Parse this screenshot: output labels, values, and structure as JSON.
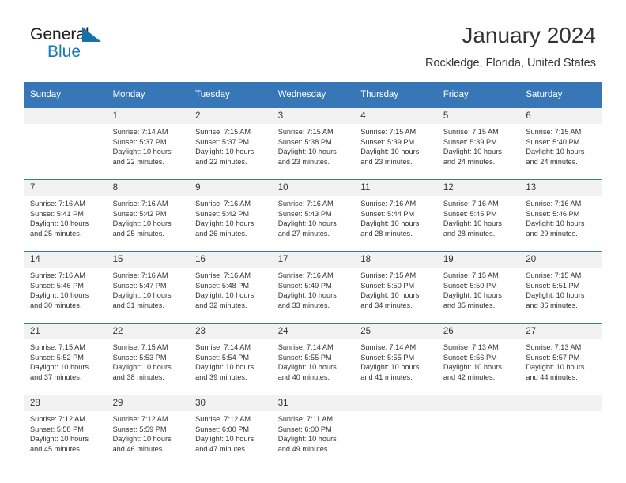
{
  "brand": {
    "name_part1": "General",
    "name_part2": "Blue",
    "accent_color": "#1278be",
    "triangle_color": "#1a6fad"
  },
  "header": {
    "title": "January 2024",
    "subtitle": "Rockledge, Florida, United States",
    "header_bg_color": "#3777b8"
  },
  "weekdays": [
    "Sunday",
    "Monday",
    "Tuesday",
    "Wednesday",
    "Thursday",
    "Friday",
    "Saturday"
  ],
  "labels": {
    "sunrise_prefix": "Sunrise:",
    "sunset_prefix": "Sunset:",
    "daylight_prefix": "Daylight:"
  },
  "weeks": [
    [
      {
        "empty": true
      },
      {
        "day": "1",
        "sunrise": "Sunrise: 7:14 AM",
        "sunset": "Sunset: 5:37 PM",
        "daylight": "Daylight: 10 hours and 22 minutes."
      },
      {
        "day": "2",
        "sunrise": "Sunrise: 7:15 AM",
        "sunset": "Sunset: 5:37 PM",
        "daylight": "Daylight: 10 hours and 22 minutes."
      },
      {
        "day": "3",
        "sunrise": "Sunrise: 7:15 AM",
        "sunset": "Sunset: 5:38 PM",
        "daylight": "Daylight: 10 hours and 23 minutes."
      },
      {
        "day": "4",
        "sunrise": "Sunrise: 7:15 AM",
        "sunset": "Sunset: 5:39 PM",
        "daylight": "Daylight: 10 hours and 23 minutes."
      },
      {
        "day": "5",
        "sunrise": "Sunrise: 7:15 AM",
        "sunset": "Sunset: 5:39 PM",
        "daylight": "Daylight: 10 hours and 24 minutes."
      },
      {
        "day": "6",
        "sunrise": "Sunrise: 7:15 AM",
        "sunset": "Sunset: 5:40 PM",
        "daylight": "Daylight: 10 hours and 24 minutes."
      }
    ],
    [
      {
        "day": "7",
        "sunrise": "Sunrise: 7:16 AM",
        "sunset": "Sunset: 5:41 PM",
        "daylight": "Daylight: 10 hours and 25 minutes."
      },
      {
        "day": "8",
        "sunrise": "Sunrise: 7:16 AM",
        "sunset": "Sunset: 5:42 PM",
        "daylight": "Daylight: 10 hours and 25 minutes."
      },
      {
        "day": "9",
        "sunrise": "Sunrise: 7:16 AM",
        "sunset": "Sunset: 5:42 PM",
        "daylight": "Daylight: 10 hours and 26 minutes."
      },
      {
        "day": "10",
        "sunrise": "Sunrise: 7:16 AM",
        "sunset": "Sunset: 5:43 PM",
        "daylight": "Daylight: 10 hours and 27 minutes."
      },
      {
        "day": "11",
        "sunrise": "Sunrise: 7:16 AM",
        "sunset": "Sunset: 5:44 PM",
        "daylight": "Daylight: 10 hours and 28 minutes."
      },
      {
        "day": "12",
        "sunrise": "Sunrise: 7:16 AM",
        "sunset": "Sunset: 5:45 PM",
        "daylight": "Daylight: 10 hours and 28 minutes."
      },
      {
        "day": "13",
        "sunrise": "Sunrise: 7:16 AM",
        "sunset": "Sunset: 5:46 PM",
        "daylight": "Daylight: 10 hours and 29 minutes."
      }
    ],
    [
      {
        "day": "14",
        "sunrise": "Sunrise: 7:16 AM",
        "sunset": "Sunset: 5:46 PM",
        "daylight": "Daylight: 10 hours and 30 minutes."
      },
      {
        "day": "15",
        "sunrise": "Sunrise: 7:16 AM",
        "sunset": "Sunset: 5:47 PM",
        "daylight": "Daylight: 10 hours and 31 minutes."
      },
      {
        "day": "16",
        "sunrise": "Sunrise: 7:16 AM",
        "sunset": "Sunset: 5:48 PM",
        "daylight": "Daylight: 10 hours and 32 minutes."
      },
      {
        "day": "17",
        "sunrise": "Sunrise: 7:16 AM",
        "sunset": "Sunset: 5:49 PM",
        "daylight": "Daylight: 10 hours and 33 minutes."
      },
      {
        "day": "18",
        "sunrise": "Sunrise: 7:15 AM",
        "sunset": "Sunset: 5:50 PM",
        "daylight": "Daylight: 10 hours and 34 minutes."
      },
      {
        "day": "19",
        "sunrise": "Sunrise: 7:15 AM",
        "sunset": "Sunset: 5:50 PM",
        "daylight": "Daylight: 10 hours and 35 minutes."
      },
      {
        "day": "20",
        "sunrise": "Sunrise: 7:15 AM",
        "sunset": "Sunset: 5:51 PM",
        "daylight": "Daylight: 10 hours and 36 minutes."
      }
    ],
    [
      {
        "day": "21",
        "sunrise": "Sunrise: 7:15 AM",
        "sunset": "Sunset: 5:52 PM",
        "daylight": "Daylight: 10 hours and 37 minutes."
      },
      {
        "day": "22",
        "sunrise": "Sunrise: 7:15 AM",
        "sunset": "Sunset: 5:53 PM",
        "daylight": "Daylight: 10 hours and 38 minutes."
      },
      {
        "day": "23",
        "sunrise": "Sunrise: 7:14 AM",
        "sunset": "Sunset: 5:54 PM",
        "daylight": "Daylight: 10 hours and 39 minutes."
      },
      {
        "day": "24",
        "sunrise": "Sunrise: 7:14 AM",
        "sunset": "Sunset: 5:55 PM",
        "daylight": "Daylight: 10 hours and 40 minutes."
      },
      {
        "day": "25",
        "sunrise": "Sunrise: 7:14 AM",
        "sunset": "Sunset: 5:55 PM",
        "daylight": "Daylight: 10 hours and 41 minutes."
      },
      {
        "day": "26",
        "sunrise": "Sunrise: 7:13 AM",
        "sunset": "Sunset: 5:56 PM",
        "daylight": "Daylight: 10 hours and 42 minutes."
      },
      {
        "day": "27",
        "sunrise": "Sunrise: 7:13 AM",
        "sunset": "Sunset: 5:57 PM",
        "daylight": "Daylight: 10 hours and 44 minutes."
      }
    ],
    [
      {
        "day": "28",
        "sunrise": "Sunrise: 7:12 AM",
        "sunset": "Sunset: 5:58 PM",
        "daylight": "Daylight: 10 hours and 45 minutes."
      },
      {
        "day": "29",
        "sunrise": "Sunrise: 7:12 AM",
        "sunset": "Sunset: 5:59 PM",
        "daylight": "Daylight: 10 hours and 46 minutes."
      },
      {
        "day": "30",
        "sunrise": "Sunrise: 7:12 AM",
        "sunset": "Sunset: 6:00 PM",
        "daylight": "Daylight: 10 hours and 47 minutes."
      },
      {
        "day": "31",
        "sunrise": "Sunrise: 7:11 AM",
        "sunset": "Sunset: 6:00 PM",
        "daylight": "Daylight: 10 hours and 49 minutes."
      },
      {
        "empty": true
      },
      {
        "empty": true
      },
      {
        "empty": true
      }
    ]
  ]
}
